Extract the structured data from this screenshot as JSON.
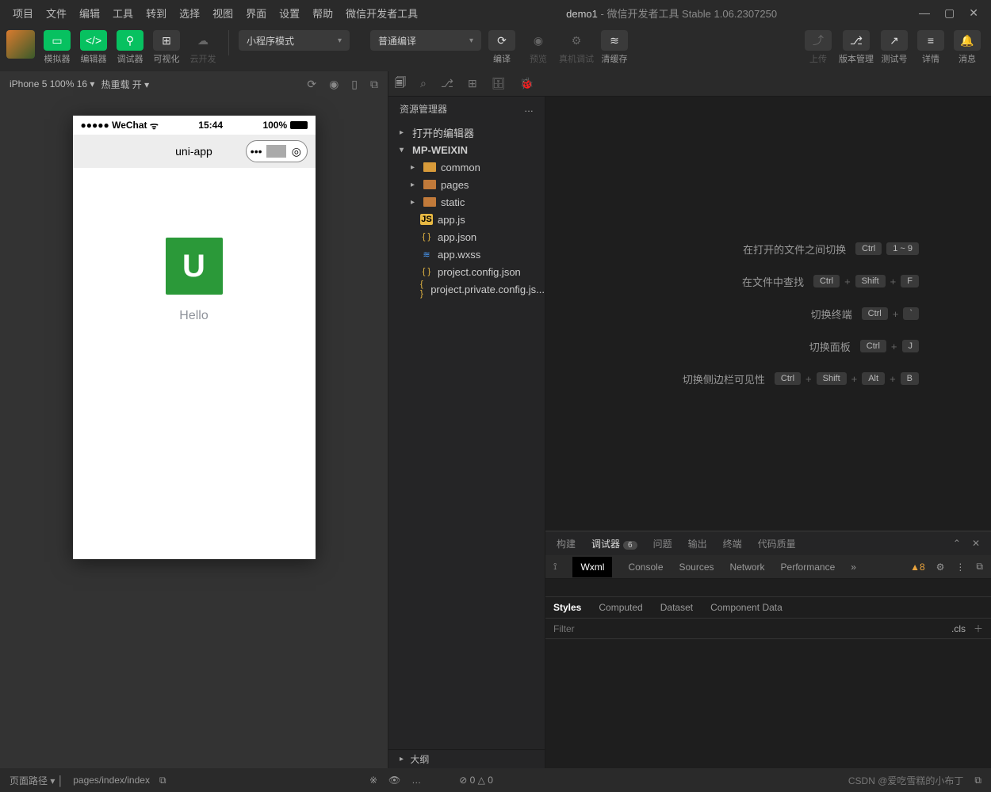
{
  "menubar": [
    "项目",
    "文件",
    "编辑",
    "工具",
    "转到",
    "选择",
    "视图",
    "界面",
    "设置",
    "帮助",
    "微信开发者工具"
  ],
  "title": {
    "project": "demo1",
    "suffix": "- 微信开发者工具 Stable 1.06.2307250"
  },
  "toolbar": {
    "simulator": "模拟器",
    "editor": "编辑器",
    "debugger": "调试器",
    "visual": "可视化",
    "cloud": "云开发",
    "modeDropdown": "小程序模式",
    "compileDropdown": "普通编译",
    "compile": "编译",
    "preview": "预览",
    "realdebug": "真机调试",
    "clearcache": "清缓存",
    "upload": "上传",
    "version": "版本管理",
    "testnum": "测试号",
    "detail": "详情",
    "notify": "消息"
  },
  "simbar": {
    "device": "iPhone 5 100% 16",
    "hotreload": "热重载 开"
  },
  "phone": {
    "carrier": "WeChat",
    "time": "15:44",
    "battery": "100%",
    "navtitle": "uni-app",
    "hello": "Hello"
  },
  "explorer": {
    "title": "资源管理器",
    "opened": "打开的编辑器",
    "root": "MP-WEIXIN",
    "items": [
      {
        "name": "common",
        "type": "folder"
      },
      {
        "name": "pages",
        "type": "folder-o"
      },
      {
        "name": "static",
        "type": "folder-o"
      },
      {
        "name": "app.js",
        "type": "js"
      },
      {
        "name": "app.json",
        "type": "json"
      },
      {
        "name": "app.wxss",
        "type": "wxss"
      },
      {
        "name": "project.config.json",
        "type": "json"
      },
      {
        "name": "project.private.config.js...",
        "type": "json"
      }
    ],
    "outline": "大纲"
  },
  "shortcuts": [
    {
      "label": "在打开的文件之间切换",
      "keys": [
        "Ctrl",
        "1 ~ 9"
      ]
    },
    {
      "label": "在文件中查找",
      "keys": [
        "Ctrl",
        "+",
        "Shift",
        "+",
        "F"
      ]
    },
    {
      "label": "切换终端",
      "keys": [
        "Ctrl",
        "+",
        "`"
      ]
    },
    {
      "label": "切换面板",
      "keys": [
        "Ctrl",
        "+",
        "J"
      ]
    },
    {
      "label": "切换侧边栏可见性",
      "keys": [
        "Ctrl",
        "+",
        "Shift",
        "+",
        "Alt",
        "+",
        "B"
      ]
    }
  ],
  "bottom": {
    "tabs": [
      "构建",
      "调试器",
      "问题",
      "输出",
      "终端",
      "代码质量"
    ],
    "debuggerBadge": "6",
    "devtabs": [
      "Wxml",
      "Console",
      "Sources",
      "Network",
      "Performance"
    ],
    "warnCount": "8",
    "styleTabs": [
      "Styles",
      "Computed",
      "Dataset",
      "Component Data"
    ],
    "filterPlaceholder": "Filter",
    "cls": ".cls"
  },
  "status": {
    "pathlabel": "页面路径",
    "path": "pages/index/index",
    "errs": "⊘ 0 △ 0",
    "watermark": "CSDN @爱吃雪糕的小布丁"
  }
}
